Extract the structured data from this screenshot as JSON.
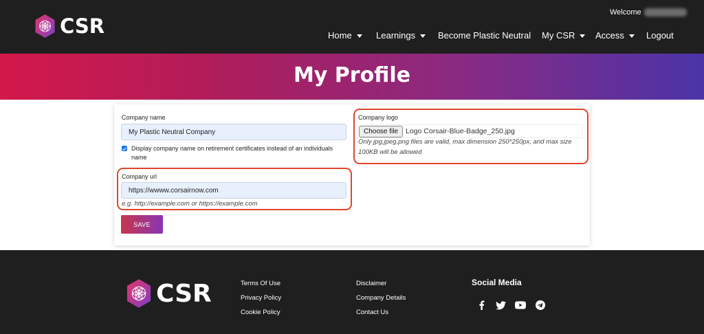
{
  "brand": {
    "name": "CSR"
  },
  "header": {
    "welcome": "Welcome",
    "nav": [
      {
        "label": "Home",
        "dropdown": true
      },
      {
        "label": "Learnings",
        "dropdown": true
      },
      {
        "label": "Become Plastic Neutral",
        "dropdown": false
      },
      {
        "label": "My CSR",
        "dropdown": true
      },
      {
        "label": "Access",
        "dropdown": true
      },
      {
        "label": "Logout",
        "dropdown": false
      }
    ]
  },
  "banner": {
    "title": "My Profile"
  },
  "form": {
    "company_name": {
      "label": "Company name",
      "value": "My Plastic Neutral Company"
    },
    "display_checkbox": {
      "checked": true,
      "label": "Display company name on retirement certificates instead of an individuals name"
    },
    "company_url": {
      "label": "Company url",
      "value": "https://wwww.corsairnow.com",
      "help": "e.g. http://example.com or https://example.com"
    },
    "company_logo": {
      "label": "Company logo",
      "button": "Choose file",
      "file_name": "Logo Corsair-Blue-Badge_250.jpg",
      "help": "Only jpg,jpeg,png files are valid, max dimension 250*250px, and max size 100KB will be allowed"
    },
    "save_label": "SAVE"
  },
  "footer": {
    "links_col1": [
      "Terms Of Use",
      "Privacy Policy",
      "Cookie Policy"
    ],
    "links_col2": [
      "Disclaimer",
      "Company Details",
      "Contact Us"
    ],
    "social_title": "Social Media",
    "social_icons": [
      "facebook-icon",
      "twitter-icon",
      "youtube-icon",
      "telegram-icon"
    ]
  },
  "colors": {
    "header_bg": "#1f1f1f",
    "banner_start": "#d4184a",
    "banner_end": "#4b34a8",
    "highlight": "#e0452a",
    "input_bg": "#e8f0fe"
  }
}
